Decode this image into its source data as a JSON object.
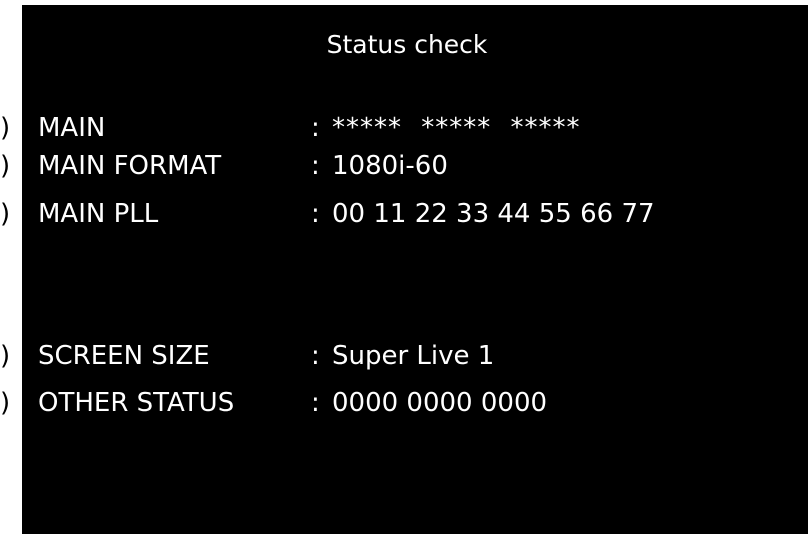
{
  "screen": {
    "title": "Status check",
    "separator": ":",
    "rows": [
      {
        "label": "MAIN",
        "value": "***** ***** *****",
        "marker": ")"
      },
      {
        "label": "MAIN FORMAT",
        "value": "1080i-60",
        "marker": ")"
      },
      {
        "label": "MAIN PLL",
        "value": "00 11 22 33 44 55 66 77",
        "marker": ")"
      },
      {
        "label": "SCREEN SIZE",
        "value": "Super Live 1",
        "marker": ")"
      },
      {
        "label": "OTHER STATUS",
        "value": "0000 0000 0000",
        "marker": ")"
      }
    ]
  },
  "colors": {
    "background": "#000000",
    "text": "#ffffff",
    "page": "#ffffff"
  }
}
